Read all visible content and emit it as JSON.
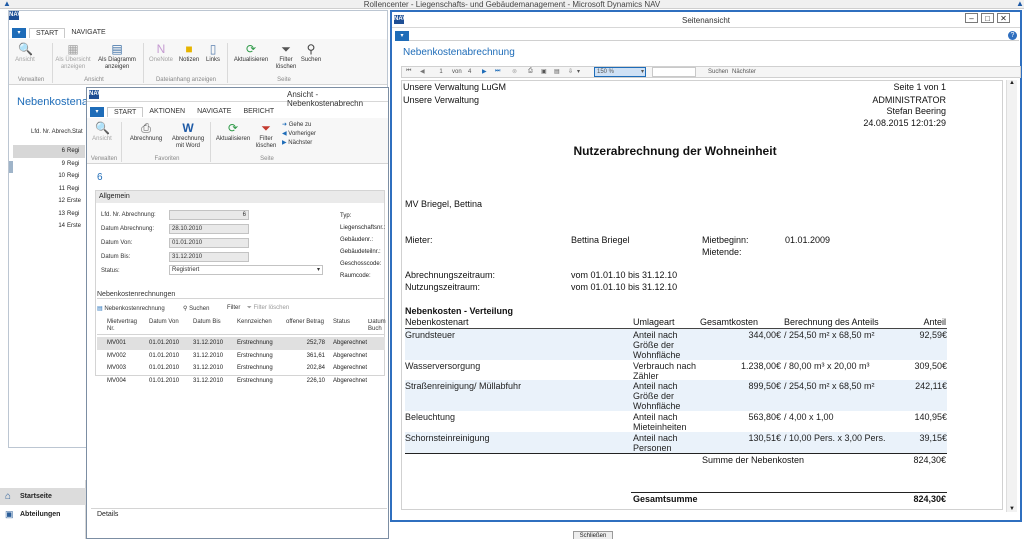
{
  "topbar": {
    "title": "Rollencenter - Liegenschafts- und Gebäudemanagement - Microsoft Dynamics NAV"
  },
  "app_logo": "NAV",
  "dropdown_glyph": "▾",
  "back_window": {
    "tabs": [
      "START",
      "NAVIGATE"
    ],
    "ribbon": {
      "buttons": [
        "Ansicht",
        "Als Übersicht anzeigen",
        "Als Diagramm anzeigen",
        "OneNote",
        "Notizen",
        "Links",
        "Aktualisieren",
        "Filter löschen",
        "Suchen"
      ],
      "groups": [
        "Verwalten",
        "Ansicht",
        "Dateianhang anzeigen",
        "Seite"
      ]
    },
    "page_title": "Nebenkostenab",
    "list_headers": [
      "Lfd. Nr. Abrech...",
      "Stat"
    ],
    "list_rows": [
      {
        "nr": "6",
        "status": "Regi"
      },
      {
        "nr": "9",
        "status": "Regi"
      },
      {
        "nr": "10",
        "status": "Regi"
      },
      {
        "nr": "11",
        "status": "Regi"
      },
      {
        "nr": "12",
        "status": "Erste"
      },
      {
        "nr": "13",
        "status": "Regi"
      },
      {
        "nr": "14",
        "status": "Erste"
      }
    ]
  },
  "nav": {
    "home": "Startseite",
    "departments": "Abteilungen"
  },
  "mid_window": {
    "title": "Ansicht - Nebenkostenabrechn",
    "tabs": [
      "START",
      "AKTIONEN",
      "NAVIGATE",
      "BERICHT"
    ],
    "ribbon": {
      "buttons": [
        "Ansicht",
        "Abrechnung",
        "Abrechnung mit Word",
        "Aktualisieren",
        "Filter löschen"
      ],
      "small": [
        "Gehe zu",
        "Vorheriger",
        "Nächster"
      ],
      "groups": [
        "Verwalten",
        "Favoriten",
        "Seite"
      ]
    },
    "record_no": "6",
    "general": {
      "header": "Allgemein",
      "fields": [
        {
          "label": "Lfd. Nr. Abrechnung:",
          "value": "6"
        },
        {
          "label": "Datum Abrechnung:",
          "value": "28.10.2010"
        },
        {
          "label": "Datum Von:",
          "value": "01.01.2010"
        },
        {
          "label": "Datum Bis:",
          "value": "31.12.2010"
        },
        {
          "label": "Status:",
          "value": "Registriert"
        }
      ],
      "right_labels": [
        "Typ:",
        "Liegenschaftsnr.:",
        "Gebäudenr.:",
        "Gebäudeteilnr.:",
        "Geschosscode:",
        "Raumcode:"
      ]
    },
    "sub": {
      "header": "Nebenkostenrechnungen",
      "actions": [
        "Nebenkostenrechnung",
        "Suchen",
        "Filter",
        "Filter löschen"
      ],
      "columns": [
        "Mietvertrag Nr.",
        "Datum Von",
        "Datum Bis",
        "Kennzeichen",
        "offener Betrag",
        "Status",
        "Datum Buch"
      ],
      "rows": [
        {
          "vertrag": "MV001",
          "von": "01.01.2010",
          "bis": "31.12.2010",
          "kz": "Erstrechnung",
          "betrag": "252,78",
          "status": "Abgerechnet"
        },
        {
          "vertrag": "MV002",
          "von": "01.01.2010",
          "bis": "31.12.2010",
          "kz": "Erstrechnung",
          "betrag": "361,61",
          "status": "Abgerechnet"
        },
        {
          "vertrag": "MV003",
          "von": "01.01.2010",
          "bis": "31.12.2010",
          "kz": "Erstrechnung",
          "betrag": "202,84",
          "status": "Abgerechnet"
        },
        {
          "vertrag": "MV004",
          "von": "01.01.2010",
          "bis": "31.12.2010",
          "kz": "Erstrechnung",
          "betrag": "226,10",
          "status": "Abgerechnet"
        }
      ]
    },
    "details": "Details"
  },
  "close_button": "Schließen",
  "preview_window": {
    "title": "Seitenansicht",
    "heading": "Nebenkostenabrechnung",
    "toolbar": {
      "page": "1",
      "of": "von",
      "total": "4",
      "zoom": "150 %",
      "search": "Suchen",
      "next": "Nächster"
    },
    "report": {
      "company1": "Unsere Verwaltung LuGM",
      "company2": "Unsere Verwaltung",
      "page_info": "Seite 1 von 1",
      "user1": "ADMINISTRATOR",
      "user2": "Stefan Beering",
      "datetime": "24.08.2015 12:01:29",
      "title": "Nutzerabrechnung der Wohneinheit",
      "unit": "MV Briegel, Bettina",
      "tenant_label": "Mieter:",
      "tenant": "Bettina Briegel",
      "lease_start_label": "Mietbeginn:",
      "lease_start": "01.01.2009",
      "lease_end_label": "Mietende:",
      "period_label": "Abrechnungszeitraum:",
      "period": "vom 01.01.10 bis 31.12.10",
      "usage_label": "Nutzungszeitraum:",
      "usage": "vom 01.01.10 bis 31.12.10",
      "section": "Nebenkosten - Verteilung",
      "columns": [
        "Nebenkostenart",
        "Umlageart",
        "Gesamtkosten",
        "Berechnung des Anteils",
        "Anteil"
      ],
      "rows": [
        {
          "art": "Grundsteuer",
          "umlage": "Anteil nach Größe der Wohnfläche",
          "gesamt": "344,00€",
          "berechnung": "/ 254,50 m² x 68,50 m²",
          "anteil": "92,59€"
        },
        {
          "art": "Wasserversorgung",
          "umlage": "Verbrauch nach Zähler",
          "gesamt": "1.238,00€",
          "berechnung": "/ 80,00 m³ x 20,00 m³",
          "anteil": "309,50€"
        },
        {
          "art": "Straßenreinigung/ Müllabfuhr",
          "umlage": "Anteil nach Größe der Wohnfläche",
          "gesamt": "899,50€",
          "berechnung": "/ 254,50 m² x 68,50 m²",
          "anteil": "242,11€"
        },
        {
          "art": "Beleuchtung",
          "umlage": "Anteil nach Mieteinheiten",
          "gesamt": "563,80€",
          "berechnung": "/ 4,00  x 1,00",
          "anteil": "140,95€"
        },
        {
          "art": "Schornsteinreinigung",
          "umlage": "Anteil  nach Personen",
          "gesamt": "130,51€",
          "berechnung": "/ 10,00 Pers. x 3,00 Pers.",
          "anteil": "39,15€"
        }
      ],
      "sum_label": "Summe der Nebenkosten",
      "sum": "824,30€",
      "total_label": "Gesamtsumme",
      "total": "824,30€"
    }
  }
}
